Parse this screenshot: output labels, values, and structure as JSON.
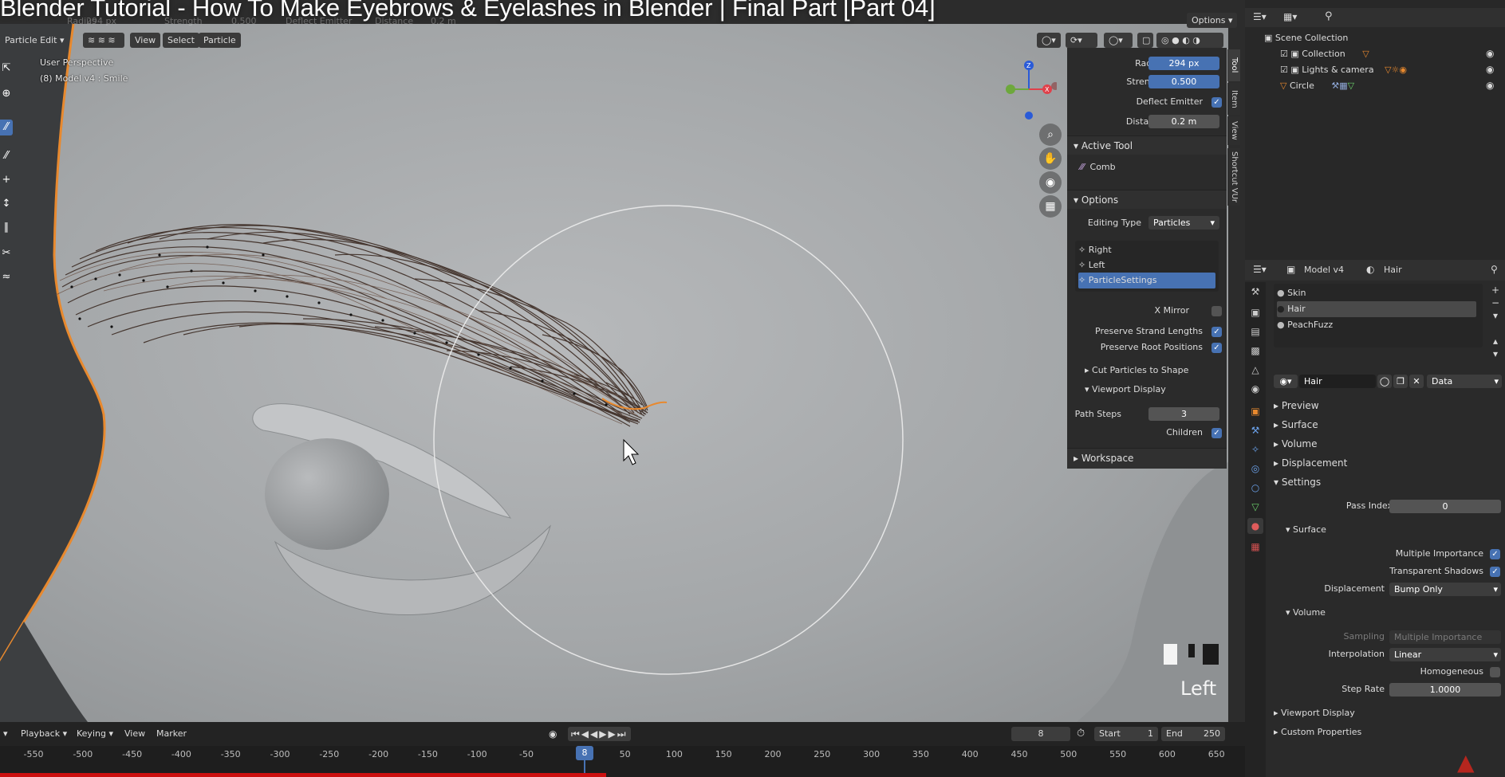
{
  "video": {
    "title": "Blender Tutorial - How To Make Eyebrows & Eyelashes in Blender | Final Part [Part 04]",
    "icons": [
      "watch-later-icon",
      "share-icon",
      "info-icon"
    ]
  },
  "header": {
    "mode": "Particle Edit",
    "menus": [
      "View",
      "Select",
      "Particle"
    ],
    "options_label": "Options",
    "top_ghost": {
      "radius_label": "Radius",
      "radius_value": "294 px",
      "strength_label": "Strength",
      "strength_value": "0.500",
      "deflect_label": "Deflect Emitter",
      "distance_label": "Distance",
      "distance_value": "0.2 m"
    }
  },
  "viewport": {
    "perspective": "User Perspective",
    "object": "(8) Model v4 : Smile",
    "view_name": "Left",
    "brush_radius": "294 px"
  },
  "npanel": {
    "tabs": [
      "Tool",
      "Item",
      "View",
      "Shortcut VUr"
    ],
    "radius_label": "Radius",
    "radius_value": "294 px",
    "strength_label": "Strength",
    "strength_value": "0.500",
    "deflect_label": "Deflect Emitter",
    "deflect_checked": true,
    "distance_label": "Distance",
    "distance_value": "0.2 m",
    "active_tool_header": "Active Tool",
    "active_tool_name": "Comb",
    "options_header": "Options",
    "editing_type_label": "Editing Type",
    "editing_type_value": "Particles",
    "particle_systems": [
      "Right",
      "Left",
      "ParticleSettings"
    ],
    "selected_system": "ParticleSettings",
    "x_mirror_label": "X Mirror",
    "x_mirror_checked": false,
    "preserve_strand_label": "Preserve Strand Lengths",
    "preserve_strand_checked": true,
    "preserve_root_label": "Preserve Root Positions",
    "preserve_root_checked": true,
    "cut_particles_label": "Cut Particles to Shape",
    "viewport_display_label": "Viewport Display",
    "path_steps_label": "Path Steps",
    "path_steps_value": "3",
    "children_label": "Children",
    "children_checked": true,
    "workspace_label": "Workspace"
  },
  "outliner": {
    "scene_collection": "Scene Collection",
    "items": [
      {
        "name": "Collection",
        "indent": 1
      },
      {
        "name": "Lights & camera",
        "indent": 1
      },
      {
        "name": "Circle",
        "indent": 1
      }
    ]
  },
  "properties": {
    "breadcrumb_object": "Model v4",
    "breadcrumb_material": "Hair",
    "material_slots": [
      "Skin",
      "Hair",
      "PeachFuzz"
    ],
    "selected_slot": "Hair",
    "material_name": "Hair",
    "data_dropdown": "Data",
    "sections": [
      "Preview",
      "Surface",
      "Volume",
      "Displacement",
      "Settings"
    ],
    "pass_index_label": "Pass Index",
    "pass_index_value": "0",
    "surface_sub": "Surface",
    "multiple_importance_label": "Multiple Importance",
    "transparent_shadows_label": "Transparent Shadows",
    "displacement_label": "Displacement",
    "displacement_value": "Bump Only",
    "volume_sub": "Volume",
    "sampling_label": "Sampling",
    "sampling_value": "Multiple Importance",
    "interpolation_label": "Interpolation",
    "interpolation_value": "Linear",
    "homogeneous_label": "Homogeneous",
    "step_rate_label": "Step Rate",
    "step_rate_value": "1.0000",
    "viewport_display_label": "Viewport Display",
    "custom_properties_label": "Custom Properties"
  },
  "timeline": {
    "menus": [
      "Playback",
      "Keying",
      "View",
      "Marker"
    ],
    "current_frame": "8",
    "start_label": "Start",
    "start_value": "1",
    "end_label": "End",
    "end_value": "250",
    "ticks": [
      "-550",
      "-500",
      "-450",
      "-400",
      "-350",
      "-300",
      "-250",
      "-200",
      "-150",
      "-100",
      "-50",
      "8",
      "50",
      "100",
      "150",
      "200",
      "250",
      "300",
      "350",
      "400",
      "450",
      "500",
      "550",
      "600",
      "650"
    ]
  },
  "colors": {
    "accent": "#4772b3",
    "selected_outline": "#e8892e",
    "panel_bg": "#2b2b2b",
    "viewport_bg": "#a9abad"
  }
}
